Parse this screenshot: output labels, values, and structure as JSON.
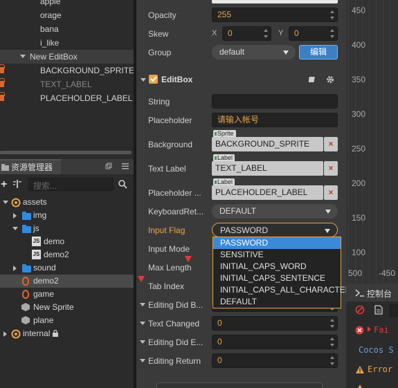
{
  "hierarchy": {
    "items": [
      {
        "label": "apple"
      },
      {
        "label": "orage"
      },
      {
        "label": "bana"
      },
      {
        "label": "i_like"
      },
      {
        "label": "New EditBox"
      },
      {
        "label": "BACKGROUND_SPRITE"
      },
      {
        "label": "TEXT_LABEL"
      },
      {
        "label": "PLACEHOLDER_LABEL"
      }
    ]
  },
  "assets": {
    "tab_label": "资源管理器",
    "search_placeholder": "搜索...",
    "items": [
      {
        "label": "assets"
      },
      {
        "label": "img"
      },
      {
        "label": "js"
      },
      {
        "label": "demo"
      },
      {
        "label": "demo2"
      },
      {
        "label": "sound"
      },
      {
        "label": "demo2"
      },
      {
        "label": "game"
      },
      {
        "label": "New Sprite"
      },
      {
        "label": "plane"
      },
      {
        "label": "internal"
      }
    ]
  },
  "inspector": {
    "opacity": {
      "label": "Opacity",
      "value": "255"
    },
    "skew": {
      "label": "Skew",
      "x_label": "X",
      "x_value": "0",
      "y_label": "Y",
      "y_value": "0"
    },
    "group": {
      "label": "Group",
      "value": "default",
      "edit_button": "编辑"
    },
    "component": {
      "title": "EditBox"
    },
    "string": {
      "label": "String",
      "value": ""
    },
    "placeholder": {
      "label": "Placeholder",
      "value": "请输入帐号"
    },
    "background": {
      "label": "Background",
      "tag": "Sprite",
      "value": "BACKGROUND_SPRITE"
    },
    "text_label": {
      "label": "Text Label",
      "tag": "Label",
      "value": "TEXT_LABEL"
    },
    "placeholder_label": {
      "label": "Placeholder ...",
      "tag": "Label",
      "value": "PLACEHOLDER_LABEL"
    },
    "keyboard_return": {
      "label": "KeyboardRet...",
      "value": "DEFAULT"
    },
    "input_flag": {
      "label": "Input Flag",
      "value": "PASSWORD"
    },
    "input_mode": {
      "label": "Input Mode"
    },
    "max_length": {
      "label": "Max Length"
    },
    "tab_index": {
      "label": "Tab Index"
    },
    "editing_did_begin": {
      "label": "Editing Did B..."
    },
    "text_changed": {
      "label": "Text Changed",
      "value": "0"
    },
    "editing_did_end": {
      "label": "Editing Did E...",
      "value": "0"
    },
    "editing_return": {
      "label": "Editing Return",
      "value": "0"
    },
    "dropdown_options": [
      "PASSWORD",
      "SENSITIVE",
      "INITIAL_CAPS_WORD",
      "INITIAL_CAPS_SENTENCE",
      "INITIAL_CAPS_ALL_CHARACTERS",
      "DEFAULT"
    ]
  },
  "canvas": {
    "y_ticks": [
      "450",
      "400",
      "350",
      "300",
      "250",
      "200",
      "150",
      "100"
    ],
    "x_ticks": [
      "500",
      "-450"
    ]
  },
  "console": {
    "tab_label": "控制台",
    "lines": [
      "Fai",
      "Cocos S",
      "Error"
    ]
  },
  "colors": {
    "accent": "#e8a34a",
    "selection": "#3b8ad8",
    "folder": "#2e8be0"
  }
}
